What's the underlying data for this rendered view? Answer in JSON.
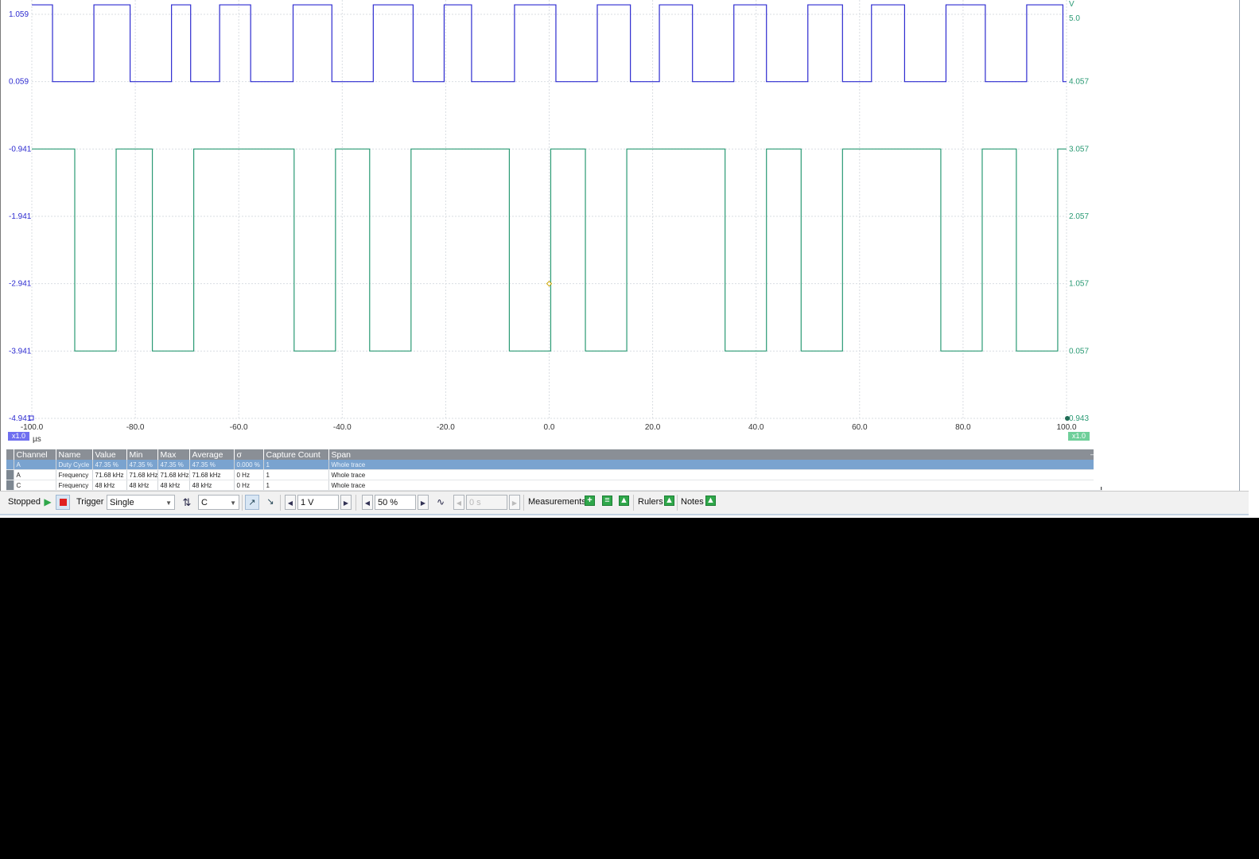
{
  "chart_data": {
    "type": "line",
    "x_unit": "µs",
    "xlim": [
      -100,
      100
    ],
    "x_ticks": [
      "-100.0",
      "-80.0",
      "-60.0",
      "-40.0",
      "-20.0",
      "0.0",
      "20.0",
      "40.0",
      "60.0",
      "80.0",
      "100.0"
    ],
    "left_axis_ticks": [
      "1.059",
      "0.059",
      "-0.941",
      "-1.941",
      "-2.941",
      "-3.941",
      "-4.941"
    ],
    "left_axis_range": [
      -4.941,
      1.059
    ],
    "right_axis_unit": "V",
    "right_axis_ticks": [
      "5.0",
      "4.057",
      "3.057",
      "2.057",
      "1.057",
      "0.057",
      "0.943"
    ],
    "grid": true,
    "trigger_marker": {
      "x": 0.0,
      "level": -2.941
    },
    "series": [
      {
        "name": "A",
        "color": "#2d2bd0",
        "axis": "left",
        "low": 0.059,
        "high": 1.2,
        "low_segments": [
          [
            -96.0,
            -88.0
          ],
          [
            -81.0,
            -73.0
          ],
          [
            -69.3,
            -63.7
          ],
          [
            -57.7,
            -49.5
          ],
          [
            -42.0,
            -34.0
          ],
          [
            -26.3,
            -20.3
          ],
          [
            -15.0,
            -6.7
          ],
          [
            1.3,
            9.3
          ],
          [
            15.7,
            21.3
          ],
          [
            27.7,
            35.7
          ],
          [
            42.0,
            50.0
          ],
          [
            56.7,
            62.3
          ],
          [
            68.7,
            76.7
          ],
          [
            84.3,
            92.3
          ],
          [
            99.3,
            100.0
          ]
        ]
      },
      {
        "name": "C",
        "color": "#2a9a74",
        "axis": "left",
        "low": -3.941,
        "high": -0.941,
        "low_segments": [
          [
            -91.7,
            -83.7
          ],
          [
            -76.7,
            -68.7
          ],
          [
            -49.3,
            -41.3
          ],
          [
            -34.7,
            -26.7
          ],
          [
            -7.7,
            0.3
          ],
          [
            7.0,
            15.0
          ],
          [
            34.0,
            42.0
          ],
          [
            48.7,
            56.7
          ],
          [
            75.7,
            83.7
          ],
          [
            90.3,
            98.3
          ]
        ]
      }
    ]
  },
  "plot": {
    "x_unit_label": "µs",
    "left_zoom_badge": "x1.0",
    "right_zoom_badge": "x1.0",
    "left_badge_color": "#6f6ff0",
    "right_badge_color": "#6fcf9a"
  },
  "measurements": {
    "headers": [
      "Channel",
      "Name",
      "Value",
      "Min",
      "Max",
      "Average",
      "σ",
      "Capture Count",
      "Span"
    ],
    "rows": [
      {
        "channel": "A",
        "name": "Duty Cycle",
        "value": "47.35 %",
        "min": "47.35 %",
        "max": "47.35 %",
        "average": "47.35 %",
        "sigma": "0.000 %",
        "count": "1",
        "span": "Whole trace"
      },
      {
        "channel": "A",
        "name": "Frequency",
        "value": "71.68 kHz",
        "min": "71.68 kHz",
        "max": "71.68 kHz",
        "average": "71.68 kHz",
        "sigma": "0 Hz",
        "count": "1",
        "span": "Whole trace"
      },
      {
        "channel": "C",
        "name": "Frequency",
        "value": "48 kHz",
        "min": "48 kHz",
        "max": "48 kHz",
        "average": "48 kHz",
        "sigma": "0 Hz",
        "count": "1",
        "span": "Whole trace"
      }
    ]
  },
  "toolbar": {
    "status": "Stopped",
    "trigger_label": "Trigger",
    "trigger_mode": "Single",
    "trigger_channel": "C",
    "threshold": "1 V",
    "pretrigger": "50 %",
    "delay": "0 s",
    "measurements_label": "Measurements",
    "rulers_label": "Rulers",
    "notes_label": "Notes"
  }
}
